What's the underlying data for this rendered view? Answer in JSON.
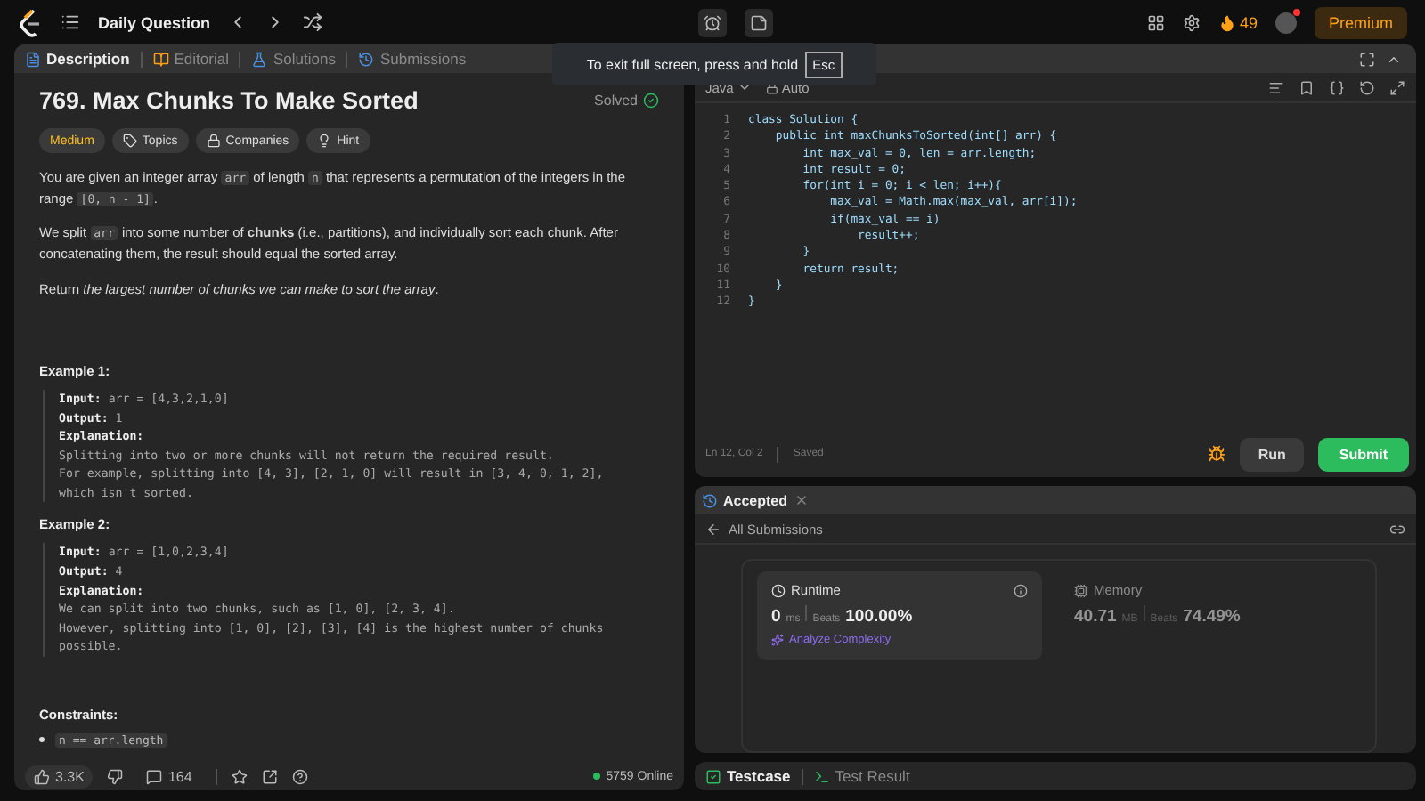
{
  "topbar": {
    "title": "Daily Question",
    "streak": "49",
    "premium": "Premium"
  },
  "toast": {
    "text": "To exit full screen, press and hold",
    "key": "Esc"
  },
  "left_tabs": [
    {
      "label": "Description",
      "selected": true
    },
    {
      "label": "Editorial",
      "selected": false
    },
    {
      "label": "Solutions",
      "selected": false
    },
    {
      "label": "Submissions",
      "selected": false
    }
  ],
  "problem": {
    "title": "769. Max Chunks To Make Sorted",
    "status": "Solved",
    "difficulty": "Medium",
    "chips": [
      "Topics",
      "Companies",
      "Hint"
    ],
    "paragraphs": [
      [
        {
          "kind": "text",
          "text": "You are given an integer array "
        },
        {
          "kind": "code",
          "text": "arr"
        },
        {
          "kind": "text",
          "text": " of length "
        },
        {
          "kind": "code",
          "text": "n"
        },
        {
          "kind": "text",
          "text": " that represents a permutation of the integers in the range "
        },
        {
          "kind": "code",
          "text": "[0, n - 1]"
        },
        {
          "kind": "text",
          "text": "."
        }
      ],
      [
        {
          "kind": "text",
          "text": "We split "
        },
        {
          "kind": "code",
          "text": "arr"
        },
        {
          "kind": "text",
          "text": " into some number of "
        },
        {
          "kind": "bold",
          "text": "chunks"
        },
        {
          "kind": "text",
          "text": " (i.e., partitions), and individually sort each chunk. After concatenating them, the result should equal the sorted array."
        }
      ],
      [
        {
          "kind": "text",
          "text": "Return "
        },
        {
          "kind": "italic",
          "text": "the largest number of chunks we can make to sort the array"
        },
        {
          "kind": "text",
          "text": "."
        }
      ]
    ],
    "examples": [
      {
        "title": "Example 1:",
        "input_label": "Input:",
        "input": "arr = [4,3,2,1,0]",
        "output_label": "Output:",
        "output": "1",
        "explanation_label": "Explanation:",
        "explanation": [
          "Splitting into two or more chunks will not return the required result.",
          "For example, splitting into [4, 3], [2, 1, 0] will result in [3, 4, 0, 1, 2],",
          "which isn't sorted."
        ]
      },
      {
        "title": "Example 2:",
        "input_label": "Input:",
        "input": "arr = [1,0,2,3,4]",
        "output_label": "Output:",
        "output": "4",
        "explanation_label": "Explanation:",
        "explanation": [
          "We can split into two chunks, such as [1, 0], [2, 3, 4].",
          "However, splitting into [1, 0], [2], [3], [4] is the highest number of chunks",
          "possible."
        ]
      }
    ],
    "constraints_title": "Constraints:",
    "constraints": [
      "n == arr.length"
    ]
  },
  "left_footer": {
    "likes": "3.3K",
    "comments": "164",
    "online": "5759 Online"
  },
  "editor": {
    "language": "Java",
    "mode": "Auto",
    "lines": [
      {
        "no": "1",
        "text": "class Solution {"
      },
      {
        "no": "2",
        "text": "    public int maxChunksToSorted(int[] arr) {"
      },
      {
        "no": "3",
        "text": "        int max_val = 0, len = arr.length;"
      },
      {
        "no": "4",
        "text": "        int result = 0;"
      },
      {
        "no": "5",
        "text": "        for(int i = 0; i < len; i++){"
      },
      {
        "no": "6",
        "text": "            max_val = Math.max(max_val, arr[i]);"
      },
      {
        "no": "7",
        "text": "            if(max_val == i)"
      },
      {
        "no": "8",
        "text": "                result++;"
      },
      {
        "no": "9",
        "text": "        }"
      },
      {
        "no": "10",
        "text": "        return result;"
      },
      {
        "no": "11",
        "text": "    }"
      },
      {
        "no": "12",
        "text": "}"
      }
    ],
    "status": "Ln 12, Col 2",
    "saved": "Saved",
    "run": "Run",
    "submit": "Submit"
  },
  "result": {
    "tab": "Accepted",
    "back": "All Submissions",
    "runtime": {
      "label": "Runtime",
      "value": "0",
      "unit": "ms",
      "beats_label": "Beats",
      "beats": "100.00%",
      "analyze": "Analyze Complexity"
    },
    "memory": {
      "label": "Memory",
      "value": "40.71",
      "unit": "MB",
      "beats_label": "Beats",
      "beats": "74.49%"
    }
  },
  "bottom_tabs": [
    {
      "label": "Testcase",
      "selected": true
    },
    {
      "label": "Test Result",
      "selected": false
    }
  ]
}
